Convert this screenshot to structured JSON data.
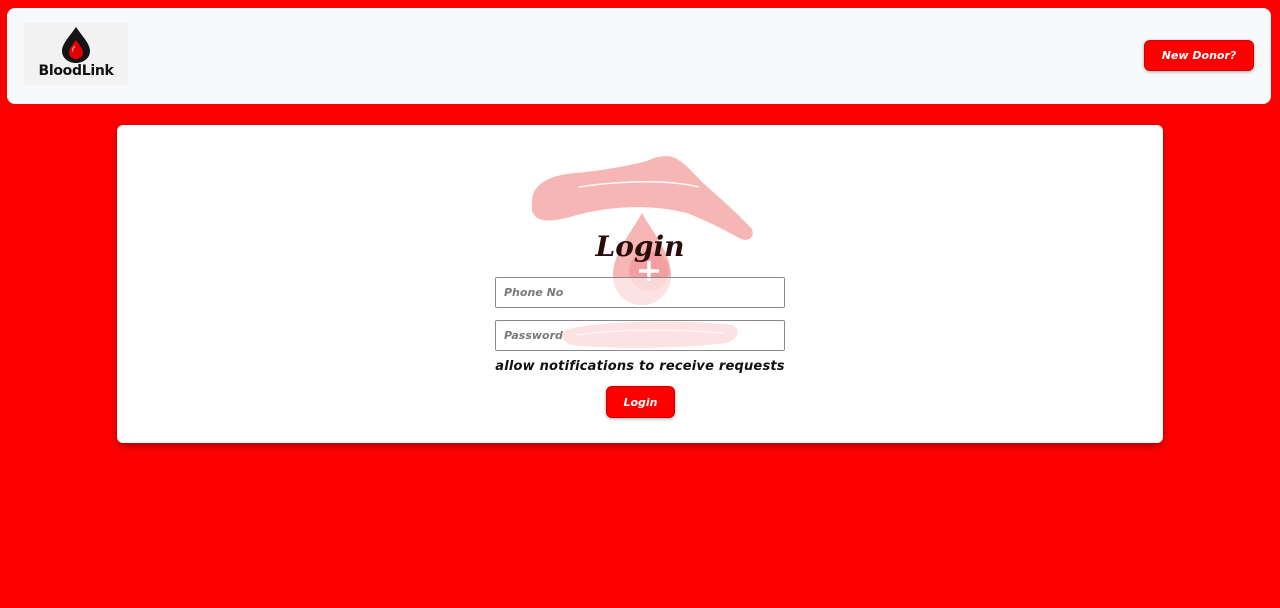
{
  "navbar": {
    "logo_text": "BloodLink",
    "new_donor_label": "New Donor?"
  },
  "login": {
    "title": "Login",
    "phone_placeholder": "Phone No",
    "password_placeholder": "Password",
    "notification_text": "allow notifications to receive requests",
    "submit_label": "Login"
  },
  "colors": {
    "page_background": "#ff0000",
    "navbar_background": "#f8f9fa",
    "card_background": "#ffffff",
    "button_background": "#ff0000",
    "watermark": "#f7b6b6"
  },
  "icons": {
    "logo": "blood-drop-icon",
    "watermark": "hand-protecting-blood-drop-icon"
  }
}
